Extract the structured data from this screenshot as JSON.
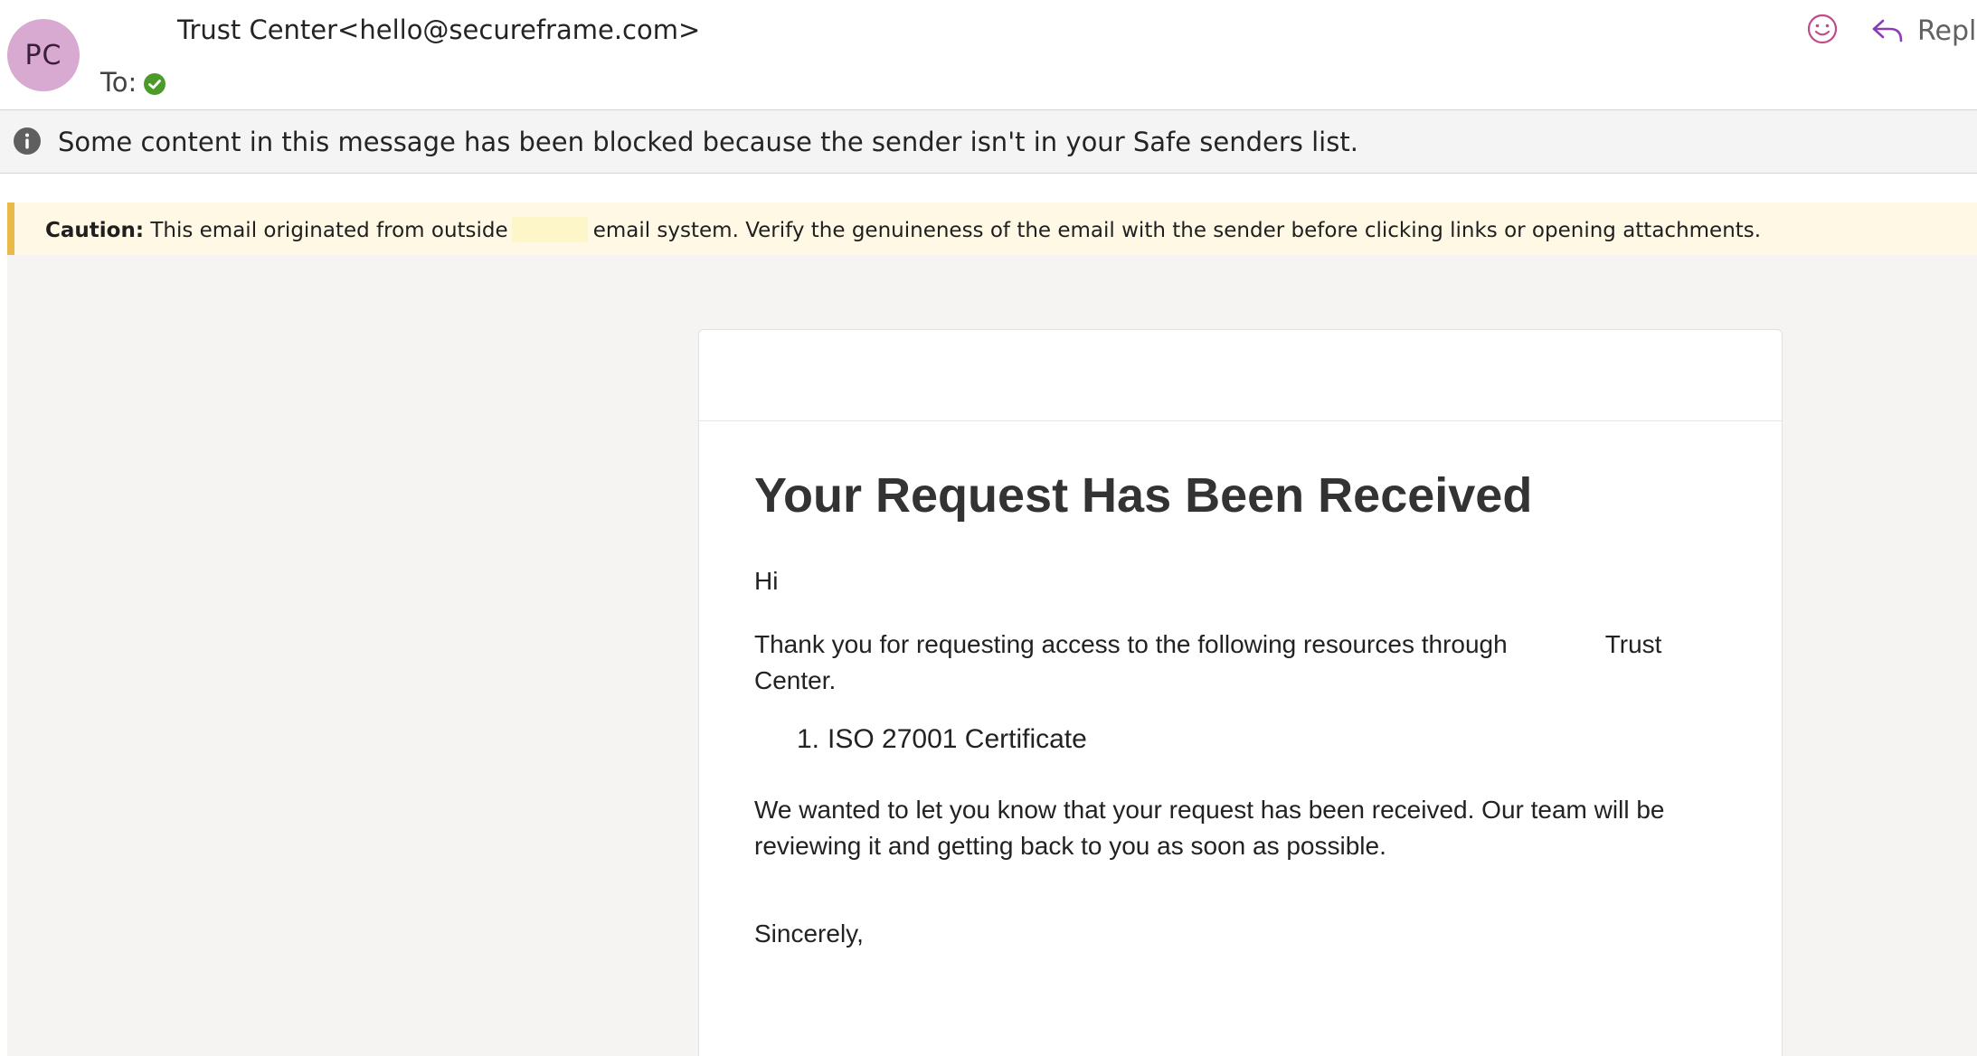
{
  "header": {
    "avatar_initials": "PC",
    "sender": "Trust Center<hello@secureframe.com>",
    "to_label": "To:",
    "reply_label": "Reply"
  },
  "info_bar": {
    "text": "Some content in this message has been blocked because the sender isn't in your Safe senders list."
  },
  "caution_banner": {
    "label": "Caution:",
    "text_before": "This email originated from outside",
    "text_after": "email system. Verify the genuineness of the email with the sender before clicking links or opening attachments."
  },
  "email": {
    "title": "Your Request Has Been Received",
    "greeting": "Hi",
    "intro_before": "Thank you for requesting access to the following resources through",
    "intro_after": "Trust Center.",
    "resources": [
      {
        "number": "1.",
        "name": "ISO 27001 Certificate"
      }
    ],
    "body": "We wanted to let you know that your request has been received. Our team will be reviewing it and getting back to you as soon as possible.",
    "signoff": "Sincerely,"
  },
  "colors": {
    "avatar_bg": "#d8a9d1",
    "caution_accent": "#e9b949",
    "caution_bg": "#fef8e5",
    "verified_green": "#4c9a2a",
    "action_purple": "#8a3db6"
  },
  "icons": {
    "emoji": "smiley-icon",
    "reply": "reply-arrow-icon",
    "info": "info-icon",
    "verified": "verified-check-icon"
  }
}
